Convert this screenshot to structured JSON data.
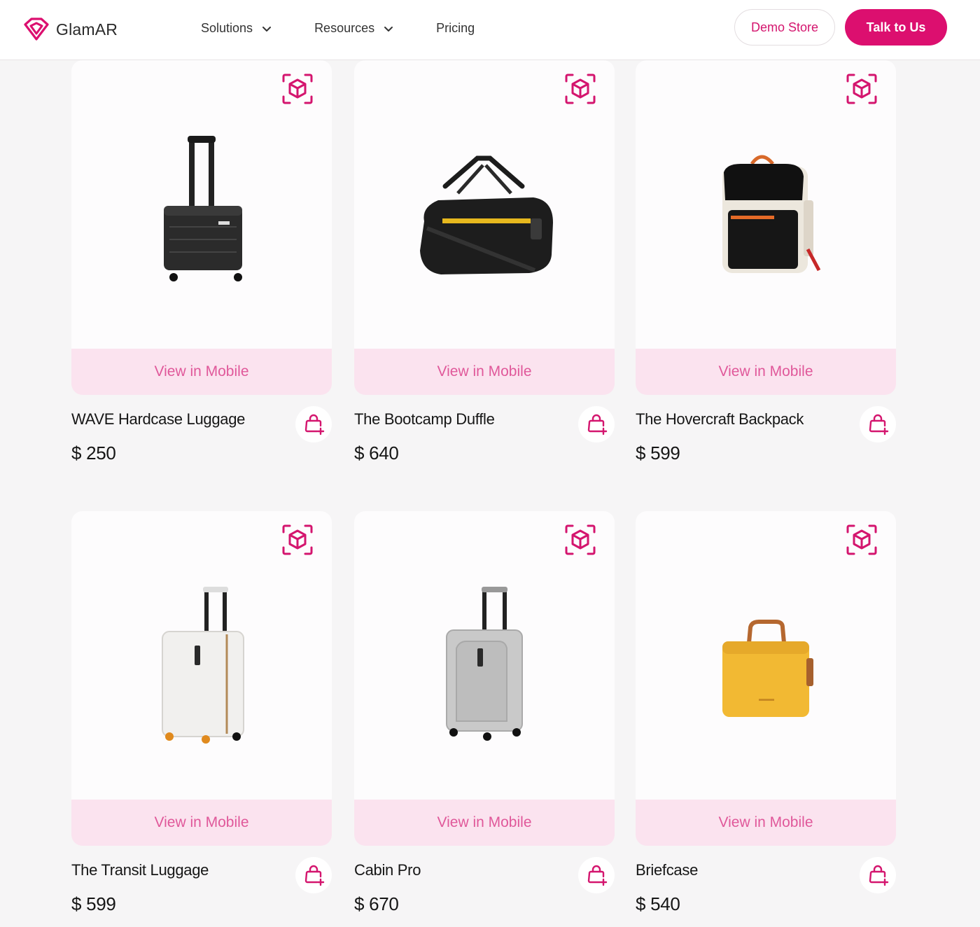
{
  "brand": {
    "name": "GlamAR",
    "accent": "#dc0f6f"
  },
  "nav": {
    "items": [
      {
        "label": "Solutions",
        "has_dropdown": true
      },
      {
        "label": "Resources",
        "has_dropdown": true
      },
      {
        "label": "Pricing",
        "has_dropdown": false
      }
    ]
  },
  "header_actions": {
    "demo_label": "Demo Store",
    "talk_label": "Talk to Us"
  },
  "products": [
    {
      "name": "WAVE Hardcase Luggage",
      "price": "$ 250",
      "cta": "View in Mobile",
      "icon": "carry-on-suitcase-black"
    },
    {
      "name": "The Bootcamp Duffle",
      "price": "$ 640",
      "cta": "View in Mobile",
      "icon": "duffle-bag-black"
    },
    {
      "name": "The Hovercraft Backpack",
      "price": "$ 599",
      "cta": "View in Mobile",
      "icon": "backpack-black-cream"
    },
    {
      "name": "The Transit Luggage",
      "price": "$ 599",
      "cta": "View in Mobile",
      "icon": "suitcase-white"
    },
    {
      "name": "Cabin Pro",
      "price": "$ 670",
      "cta": "View in Mobile",
      "icon": "suitcase-silver"
    },
    {
      "name": "Briefcase",
      "price": "$ 540",
      "cta": "View in Mobile",
      "icon": "briefcase-yellow"
    }
  ]
}
